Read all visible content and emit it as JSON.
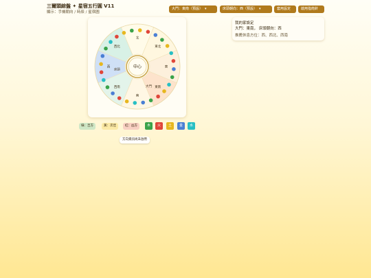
{
  "header": {
    "title": "三爾頭綜盤 ✦ 星宿五行圓 V11",
    "subtitle": "顯示：手機朝向 / 時辰 / 星宿圖"
  },
  "toolbar": {
    "door_select": "大門：東南（預設）",
    "bed_select": "床頭朝向：西（預設）",
    "apply_label": "套用設定",
    "compass_label": "啟用指南針"
  },
  "wheel": {
    "center_label": "中心",
    "sector_labels": [
      "北",
      "東北",
      "東",
      "東南",
      "南",
      "西南",
      "西",
      "西北"
    ],
    "markers": {
      "door": "大門",
      "bed": "床頭"
    }
  },
  "info": {
    "heading": "我的家設定",
    "door_line": "大門：東南，",
    "bed_line": "床頭朝向：西",
    "recommend": "推薦休息方位：西、西北、西南"
  },
  "legend": {
    "green": "綠：吉方",
    "yellow": "黃：次佳",
    "red": "紅：凶方"
  },
  "elements": [
    {
      "label": "木",
      "color": "#3aa34a"
    },
    {
      "label": "火",
      "color": "#e0463a"
    },
    {
      "label": "土",
      "color": "#e7b71f"
    },
    {
      "label": "金",
      "color": "#4a7fd4"
    },
    {
      "label": "水",
      "color": "#28bfc4"
    }
  ],
  "notice": "方向資訊尚未啟用",
  "colors": {
    "accent": "#b07a1c"
  }
}
